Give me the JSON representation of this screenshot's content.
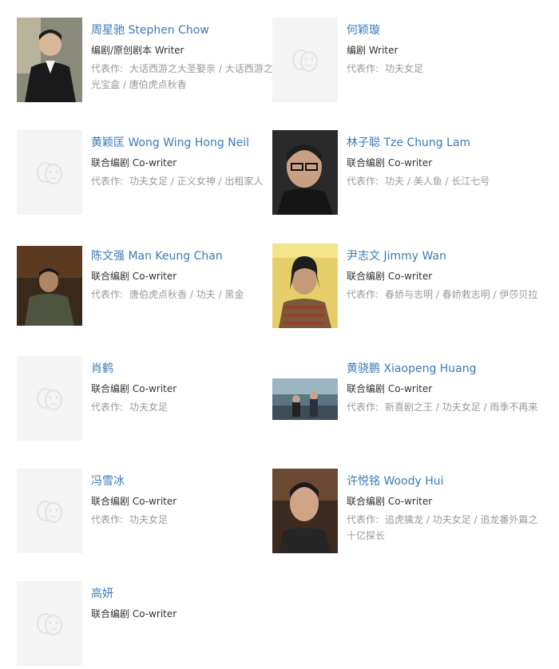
{
  "works_label": "代表作:",
  "people": [
    {
      "name": "周星驰 Stephen Chow",
      "role": "编剧/原创剧本 Writer",
      "works": "大话西游之大圣娶亲 / 大话西游之月光宝盒 / 唐伯虎点秋香",
      "photo": "stephen-chow"
    },
    {
      "name": "何颖璇",
      "role": "编剧 Writer",
      "works": "功夫女足",
      "photo": "placeholder"
    },
    {
      "name": "黄颖匡 Wong Wing Hong Neil",
      "role": "联合编剧 Co-writer",
      "works": "功夫女足 / 正义女神 / 出租家人",
      "photo": "placeholder"
    },
    {
      "name": "林子聪 Tze Chung Lam",
      "role": "联合编剧 Co-writer",
      "works": "功夫 / 美人鱼 / 长江七号",
      "photo": "tze-chung-lam"
    },
    {
      "name": "陈文强 Man Keung Chan",
      "role": "联合编剧 Co-writer",
      "works": "唐伯虎点秋香 / 功夫 / 黑金",
      "photo": "man-keung-chan"
    },
    {
      "name": "尹志文 Jimmy Wan",
      "role": "联合编剧 Co-writer",
      "works": "春娇与志明 / 春娇救志明 / 伊莎贝拉",
      "photo": "jimmy-wan"
    },
    {
      "name": "肖鹤",
      "role": "联合编剧 Co-writer",
      "works": "功夫女足",
      "photo": "placeholder"
    },
    {
      "name": "黄骁鹏 Xiaopeng Huang",
      "role": "联合编剧 Co-writer",
      "works": "新喜剧之王 / 功夫女足 / 雨季不再来",
      "photo": "xiaopeng-huang"
    },
    {
      "name": "冯雪冰",
      "role": "联合编剧 Co-writer",
      "works": "功夫女足",
      "photo": "placeholder"
    },
    {
      "name": "许悦铭 Woody Hui",
      "role": "联合编剧 Co-writer",
      "works": "追虎擒龙 / 功夫女足 / 追龙番外篇之十亿探长",
      "photo": "woody-hui"
    },
    {
      "name": "高妍",
      "role": "联合编剧 Co-writer",
      "works": "",
      "photo": "placeholder"
    }
  ]
}
